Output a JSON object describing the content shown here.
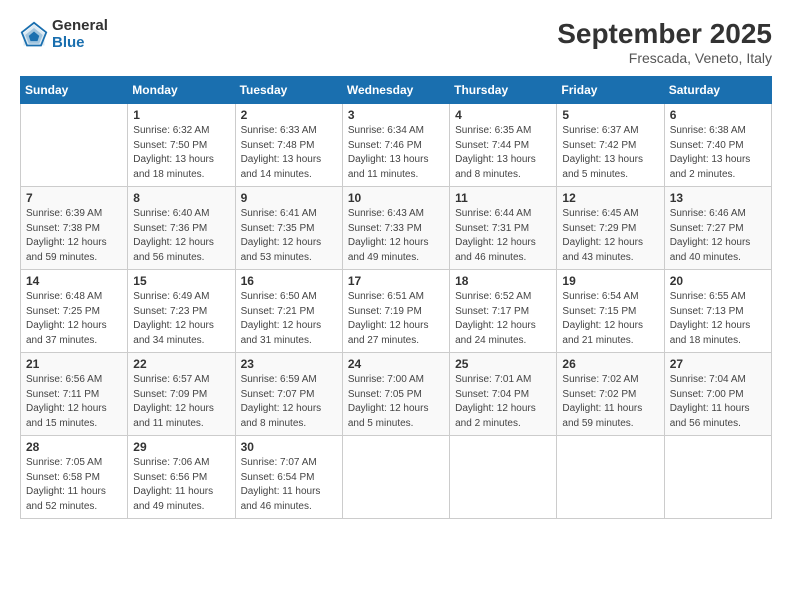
{
  "header": {
    "logo_general": "General",
    "logo_blue": "Blue",
    "month_title": "September 2025",
    "location": "Frescada, Veneto, Italy"
  },
  "weekdays": [
    "Sunday",
    "Monday",
    "Tuesday",
    "Wednesday",
    "Thursday",
    "Friday",
    "Saturday"
  ],
  "weeks": [
    [
      {
        "num": "",
        "info": ""
      },
      {
        "num": "1",
        "info": "Sunrise: 6:32 AM\nSunset: 7:50 PM\nDaylight: 13 hours\nand 18 minutes."
      },
      {
        "num": "2",
        "info": "Sunrise: 6:33 AM\nSunset: 7:48 PM\nDaylight: 13 hours\nand 14 minutes."
      },
      {
        "num": "3",
        "info": "Sunrise: 6:34 AM\nSunset: 7:46 PM\nDaylight: 13 hours\nand 11 minutes."
      },
      {
        "num": "4",
        "info": "Sunrise: 6:35 AM\nSunset: 7:44 PM\nDaylight: 13 hours\nand 8 minutes."
      },
      {
        "num": "5",
        "info": "Sunrise: 6:37 AM\nSunset: 7:42 PM\nDaylight: 13 hours\nand 5 minutes."
      },
      {
        "num": "6",
        "info": "Sunrise: 6:38 AM\nSunset: 7:40 PM\nDaylight: 13 hours\nand 2 minutes."
      }
    ],
    [
      {
        "num": "7",
        "info": "Sunrise: 6:39 AM\nSunset: 7:38 PM\nDaylight: 12 hours\nand 59 minutes."
      },
      {
        "num": "8",
        "info": "Sunrise: 6:40 AM\nSunset: 7:36 PM\nDaylight: 12 hours\nand 56 minutes."
      },
      {
        "num": "9",
        "info": "Sunrise: 6:41 AM\nSunset: 7:35 PM\nDaylight: 12 hours\nand 53 minutes."
      },
      {
        "num": "10",
        "info": "Sunrise: 6:43 AM\nSunset: 7:33 PM\nDaylight: 12 hours\nand 49 minutes."
      },
      {
        "num": "11",
        "info": "Sunrise: 6:44 AM\nSunset: 7:31 PM\nDaylight: 12 hours\nand 46 minutes."
      },
      {
        "num": "12",
        "info": "Sunrise: 6:45 AM\nSunset: 7:29 PM\nDaylight: 12 hours\nand 43 minutes."
      },
      {
        "num": "13",
        "info": "Sunrise: 6:46 AM\nSunset: 7:27 PM\nDaylight: 12 hours\nand 40 minutes."
      }
    ],
    [
      {
        "num": "14",
        "info": "Sunrise: 6:48 AM\nSunset: 7:25 PM\nDaylight: 12 hours\nand 37 minutes."
      },
      {
        "num": "15",
        "info": "Sunrise: 6:49 AM\nSunset: 7:23 PM\nDaylight: 12 hours\nand 34 minutes."
      },
      {
        "num": "16",
        "info": "Sunrise: 6:50 AM\nSunset: 7:21 PM\nDaylight: 12 hours\nand 31 minutes."
      },
      {
        "num": "17",
        "info": "Sunrise: 6:51 AM\nSunset: 7:19 PM\nDaylight: 12 hours\nand 27 minutes."
      },
      {
        "num": "18",
        "info": "Sunrise: 6:52 AM\nSunset: 7:17 PM\nDaylight: 12 hours\nand 24 minutes."
      },
      {
        "num": "19",
        "info": "Sunrise: 6:54 AM\nSunset: 7:15 PM\nDaylight: 12 hours\nand 21 minutes."
      },
      {
        "num": "20",
        "info": "Sunrise: 6:55 AM\nSunset: 7:13 PM\nDaylight: 12 hours\nand 18 minutes."
      }
    ],
    [
      {
        "num": "21",
        "info": "Sunrise: 6:56 AM\nSunset: 7:11 PM\nDaylight: 12 hours\nand 15 minutes."
      },
      {
        "num": "22",
        "info": "Sunrise: 6:57 AM\nSunset: 7:09 PM\nDaylight: 12 hours\nand 11 minutes."
      },
      {
        "num": "23",
        "info": "Sunrise: 6:59 AM\nSunset: 7:07 PM\nDaylight: 12 hours\nand 8 minutes."
      },
      {
        "num": "24",
        "info": "Sunrise: 7:00 AM\nSunset: 7:05 PM\nDaylight: 12 hours\nand 5 minutes."
      },
      {
        "num": "25",
        "info": "Sunrise: 7:01 AM\nSunset: 7:04 PM\nDaylight: 12 hours\nand 2 minutes."
      },
      {
        "num": "26",
        "info": "Sunrise: 7:02 AM\nSunset: 7:02 PM\nDaylight: 11 hours\nand 59 minutes."
      },
      {
        "num": "27",
        "info": "Sunrise: 7:04 AM\nSunset: 7:00 PM\nDaylight: 11 hours\nand 56 minutes."
      }
    ],
    [
      {
        "num": "28",
        "info": "Sunrise: 7:05 AM\nSunset: 6:58 PM\nDaylight: 11 hours\nand 52 minutes."
      },
      {
        "num": "29",
        "info": "Sunrise: 7:06 AM\nSunset: 6:56 PM\nDaylight: 11 hours\nand 49 minutes."
      },
      {
        "num": "30",
        "info": "Sunrise: 7:07 AM\nSunset: 6:54 PM\nDaylight: 11 hours\nand 46 minutes."
      },
      {
        "num": "",
        "info": ""
      },
      {
        "num": "",
        "info": ""
      },
      {
        "num": "",
        "info": ""
      },
      {
        "num": "",
        "info": ""
      }
    ]
  ]
}
